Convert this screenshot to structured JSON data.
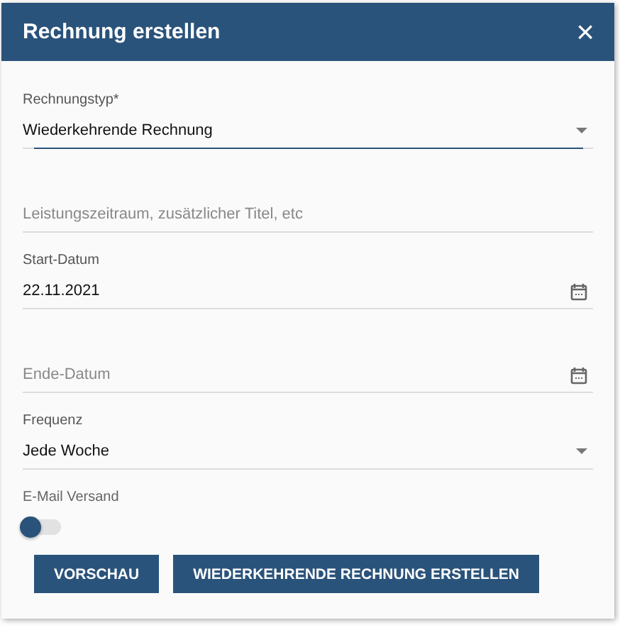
{
  "dialog": {
    "title": "Rechnung erstellen",
    "close": "×"
  },
  "fields": [
    {
      "kind": "select",
      "label": "Rechnungstyp*",
      "value": "Wiederkehrende Rechnung",
      "focused": true
    },
    {
      "kind": "text",
      "placeholder": "Leistungszeitraum, zusätzlicher Titel, etc"
    },
    {
      "kind": "date",
      "label": "Start-Datum",
      "value": "22.11.2021"
    },
    {
      "kind": "date",
      "placeholder": "Ende-Datum"
    },
    {
      "kind": "select",
      "label": "Frequenz",
      "value": "Jede Woche",
      "focused": false
    }
  ],
  "email_toggle": {
    "label": "E-Mail Versand",
    "on": false
  },
  "buttons": [
    "VORSCHAU",
    "WIEDERKEHRENDE RECHNUNG ERSTELLEN"
  ]
}
